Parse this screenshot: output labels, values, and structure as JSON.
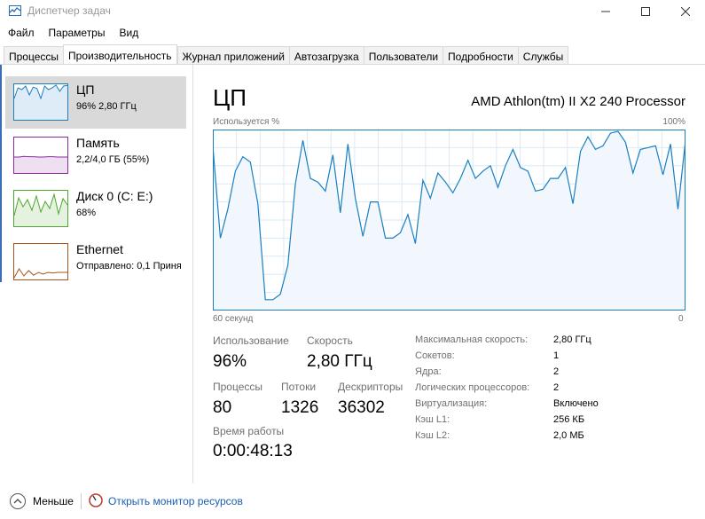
{
  "window": {
    "title": "Диспетчер задач",
    "icon": "task-manager-icon"
  },
  "menu": [
    "Файл",
    "Параметры",
    "Вид"
  ],
  "tabs": [
    {
      "label": "Процессы",
      "active": false
    },
    {
      "label": "Производительность",
      "active": true
    },
    {
      "label": "Журнал приложений",
      "active": false
    },
    {
      "label": "Автозагрузка",
      "active": false
    },
    {
      "label": "Пользователи",
      "active": false
    },
    {
      "label": "Подробности",
      "active": false
    },
    {
      "label": "Службы",
      "active": false
    }
  ],
  "sidebar": {
    "items": [
      {
        "title": "ЦП",
        "sub": "96% 2,80 ГГц",
        "color": "#1a7fc1",
        "selected": true
      },
      {
        "title": "Память",
        "sub": "2,2/4,0 ГБ (55%)",
        "color": "#8b2c9e",
        "selected": false
      },
      {
        "title": "Диск 0 (C: E:)",
        "sub": "68%",
        "color": "#4ea72e",
        "selected": false
      },
      {
        "title": "Ethernet",
        "sub": "Отправлено: 0,1 Приня",
        "color": "#a6541a",
        "selected": false
      }
    ]
  },
  "main": {
    "title": "ЦП",
    "cpu_name": "AMD Athlon(tm) II X2 240 Processor",
    "usage_label": "Используется %",
    "usage_max": "100%",
    "axis_left": "60 секунд",
    "axis_right": "0",
    "graph_color": "#1a7fc1",
    "graph_values": [
      91,
      40,
      56,
      77,
      85,
      82,
      59,
      6,
      6,
      9,
      25,
      70,
      94,
      73,
      71,
      66,
      86,
      54,
      92,
      62,
      41,
      60,
      60,
      40,
      40,
      43,
      53,
      37,
      72,
      62,
      76,
      71,
      65,
      73,
      83,
      73,
      77,
      80,
      68,
      80,
      89,
      79,
      77,
      66,
      67,
      73,
      73,
      79,
      59,
      88,
      96,
      89,
      91,
      98,
      99,
      93,
      76,
      89,
      90,
      91,
      75,
      92,
      56,
      94
    ],
    "stats": {
      "usage_label": "Использование",
      "usage_value": "96%",
      "speed_label": "Скорость",
      "speed_value": "2,80 ГГц",
      "processes_label": "Процессы",
      "processes_value": "80",
      "threads_label": "Потоки",
      "threads_value": "1326",
      "handles_label": "Дескрипторы",
      "handles_value": "36302",
      "uptime_label": "Время работы",
      "uptime_value": "0:00:48:13"
    },
    "specs": [
      {
        "label": "Максимальная скорость:",
        "value": "2,80 ГГц"
      },
      {
        "label": "Сокетов:",
        "value": "1"
      },
      {
        "label": "Ядра:",
        "value": "2"
      },
      {
        "label": "Логических процессоров:",
        "value": "2"
      },
      {
        "label": "Виртуализация:",
        "value": "Включено"
      },
      {
        "label": "Кэш L1:",
        "value": "256 КБ"
      },
      {
        "label": "Кэш L2:",
        "value": "2,0 МБ"
      }
    ]
  },
  "footer": {
    "less_label": "Меньше",
    "monitor_label": "Открыть монитор ресурсов"
  }
}
